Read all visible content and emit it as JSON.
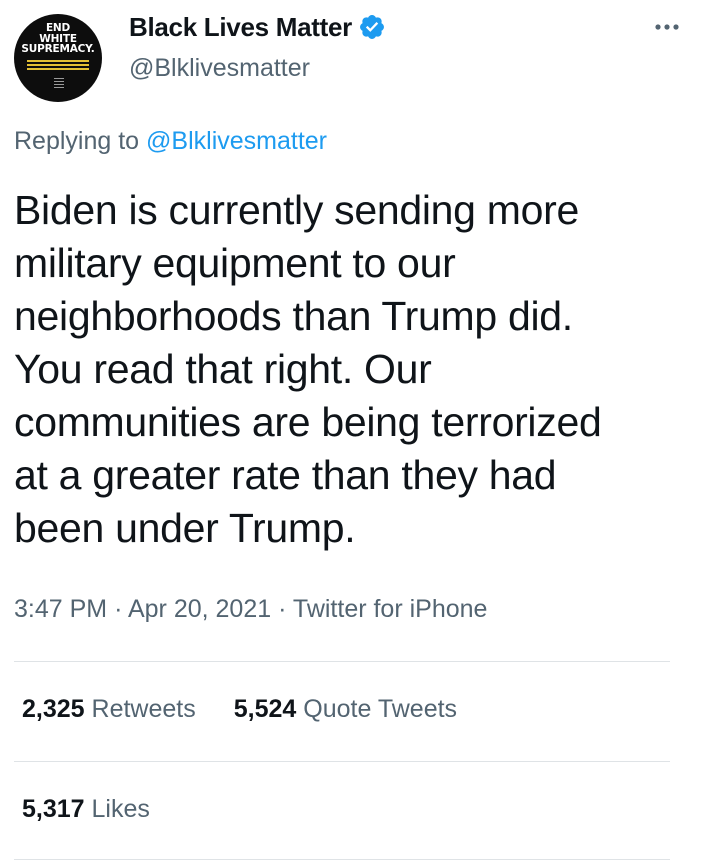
{
  "author": {
    "display_name": "Black Lives Matter",
    "handle": "@Blklivesmatter",
    "avatar_text": [
      "END",
      "WHITE",
      "SUPREMACY."
    ],
    "verified": true
  },
  "reply": {
    "prefix": "Replying to",
    "handle": "@Blklivesmatter"
  },
  "tweet": {
    "text": "Biden is currently sending more\nmilitary equipment to our\nneighborhoods than Trump did.\nYou read that right. Our\ncommunities are being terrorized\nat a greater rate than they had\nbeen under Trump."
  },
  "meta": {
    "time": "3:47 PM",
    "date": "Apr 20, 2021",
    "source": "Twitter for iPhone",
    "separator": "·"
  },
  "stats": {
    "retweets": {
      "count": "2,325",
      "label": "Retweets"
    },
    "quote_tweets": {
      "count": "5,524",
      "label": "Quote Tweets"
    },
    "likes": {
      "count": "5,317",
      "label": "Likes"
    }
  },
  "colors": {
    "accent": "#1d9bf0",
    "secondary_text": "#536471",
    "primary_text": "#0f1419",
    "divider": "#dfe3e6",
    "avatar_stripe": "#e3c034"
  },
  "icons": {
    "verified": "verified-badge-icon",
    "more": "more-options-icon"
  }
}
